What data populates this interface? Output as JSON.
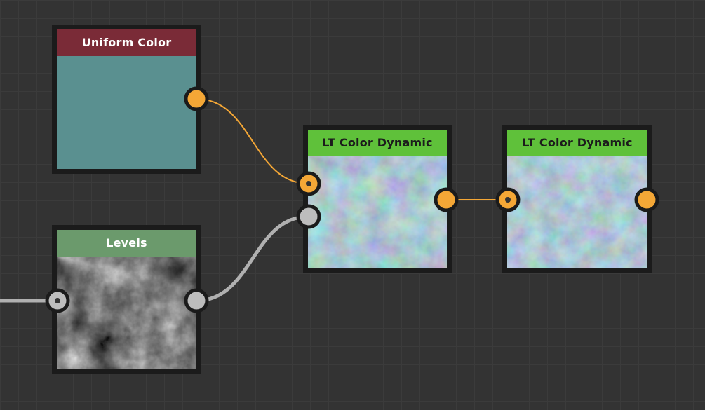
{
  "canvas": {
    "background": "#333333",
    "grid_color": "#3b3b3b"
  },
  "nodes": {
    "uniform_color": {
      "title": "Uniform Color",
      "header_color": "#7a2b37",
      "preview_color": "#5a9090"
    },
    "levels": {
      "title": "Levels",
      "header_color": "#6b9a6c",
      "preview": "grayscale-noise"
    },
    "lt_color_dynamic_1": {
      "title": "LT Color Dynamic",
      "header_color": "#5fc13a",
      "preview": "teal-noise"
    },
    "lt_color_dynamic_2": {
      "title": "LT Color Dynamic",
      "header_color": "#5fc13a",
      "preview": "teal-noise"
    }
  },
  "port_colors": {
    "color": "#f4a736",
    "grayscale": "#bdbdbd"
  },
  "link_colors": {
    "color": "#f4a736",
    "grayscale": "#b0b0b0"
  }
}
